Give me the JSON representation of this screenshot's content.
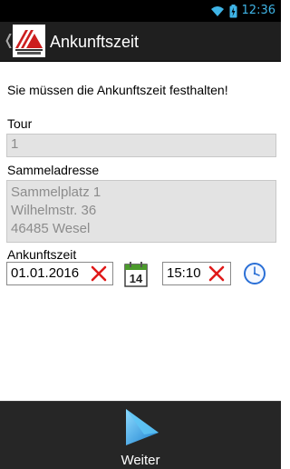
{
  "statusbar": {
    "time": "12:36",
    "wifi_icon": "wifi-icon",
    "battery_icon": "battery-charging-icon",
    "accent": "#3fb4e6"
  },
  "actionbar": {
    "title": "Ankunftszeit",
    "up_icon": "chevron-left-icon",
    "logo_icon": "app-logo-icon",
    "background": "#1f1f1f"
  },
  "main": {
    "message": "Sie müssen die Ankunftszeit festhalten!",
    "tour": {
      "label": "Tour",
      "value": "1"
    },
    "address": {
      "label": "Sammeladresse",
      "lines": [
        "Sammelplatz 1",
        "Wilhelmstr. 36",
        "46485 Wesel"
      ]
    },
    "arrival": {
      "label": "Ankunftszeit",
      "date": "01.01.2016",
      "time": "15:10",
      "calendar_day": "14",
      "clear_icon": "clear-x-icon",
      "calendar_icon": "calendar-icon",
      "clock_icon": "clock-icon"
    }
  },
  "footer": {
    "next_label": "Weiter",
    "next_icon": "play-arrow-icon"
  }
}
